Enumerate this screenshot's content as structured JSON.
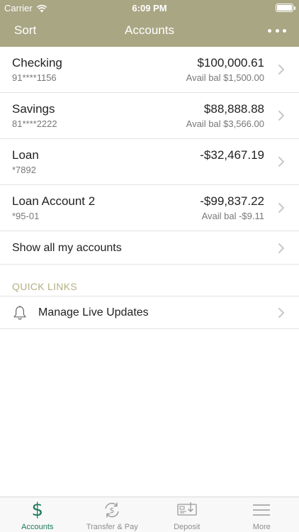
{
  "status_bar": {
    "carrier": "Carrier",
    "time": "6:09 PM"
  },
  "nav": {
    "left_action": "Sort",
    "title": "Accounts"
  },
  "accounts": [
    {
      "name": "Checking",
      "number": "91****1156",
      "balance": "$100,000.61",
      "available": "Avail bal $1,500.00"
    },
    {
      "name": "Savings",
      "number": "81****2222",
      "balance": "$88,888.88",
      "available": "Avail bal $3,566.00"
    },
    {
      "name": "Loan",
      "number": "*7892",
      "balance": "-$32,467.19",
      "available": ""
    },
    {
      "name": "Loan Account 2",
      "number": "*95-01",
      "balance": "-$99,837.22",
      "available": "Avail bal -$9.11"
    }
  ],
  "show_all": "Show all my accounts",
  "quick_links": {
    "title": "QUICK LINKS",
    "items": [
      {
        "label": "Manage Live Updates",
        "icon": "bell-icon"
      }
    ]
  },
  "tabs": [
    {
      "label": "Accounts",
      "icon": "dollar-icon",
      "active": true
    },
    {
      "label": "Transfer & Pay",
      "icon": "transfer-icon",
      "active": false
    },
    {
      "label": "Deposit",
      "icon": "deposit-check-icon",
      "active": false
    },
    {
      "label": "More",
      "icon": "menu-icon",
      "active": false
    }
  ],
  "colors": {
    "header": "#a9a684",
    "accent": "#1e7a5a",
    "section_title": "#b3b084"
  }
}
